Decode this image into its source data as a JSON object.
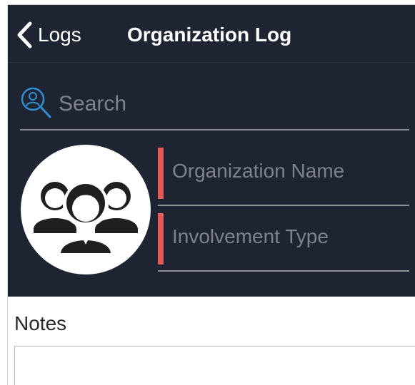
{
  "navbar": {
    "back_label": "Logs",
    "title": "Organization Log"
  },
  "search": {
    "placeholder": "Search",
    "icon": "search-person-icon"
  },
  "avatar": {
    "icon": "group-people-icon"
  },
  "fields": {
    "organization_name_placeholder": "Organization Name",
    "involvement_type_placeholder": "Involvement Type"
  },
  "notes": {
    "label": "Notes",
    "value": ""
  },
  "colors": {
    "header_bg": "#1f2433",
    "required_bar": "#e85a5a",
    "search_icon": "#2f8fd0",
    "placeholder_text": "#7e828a"
  }
}
